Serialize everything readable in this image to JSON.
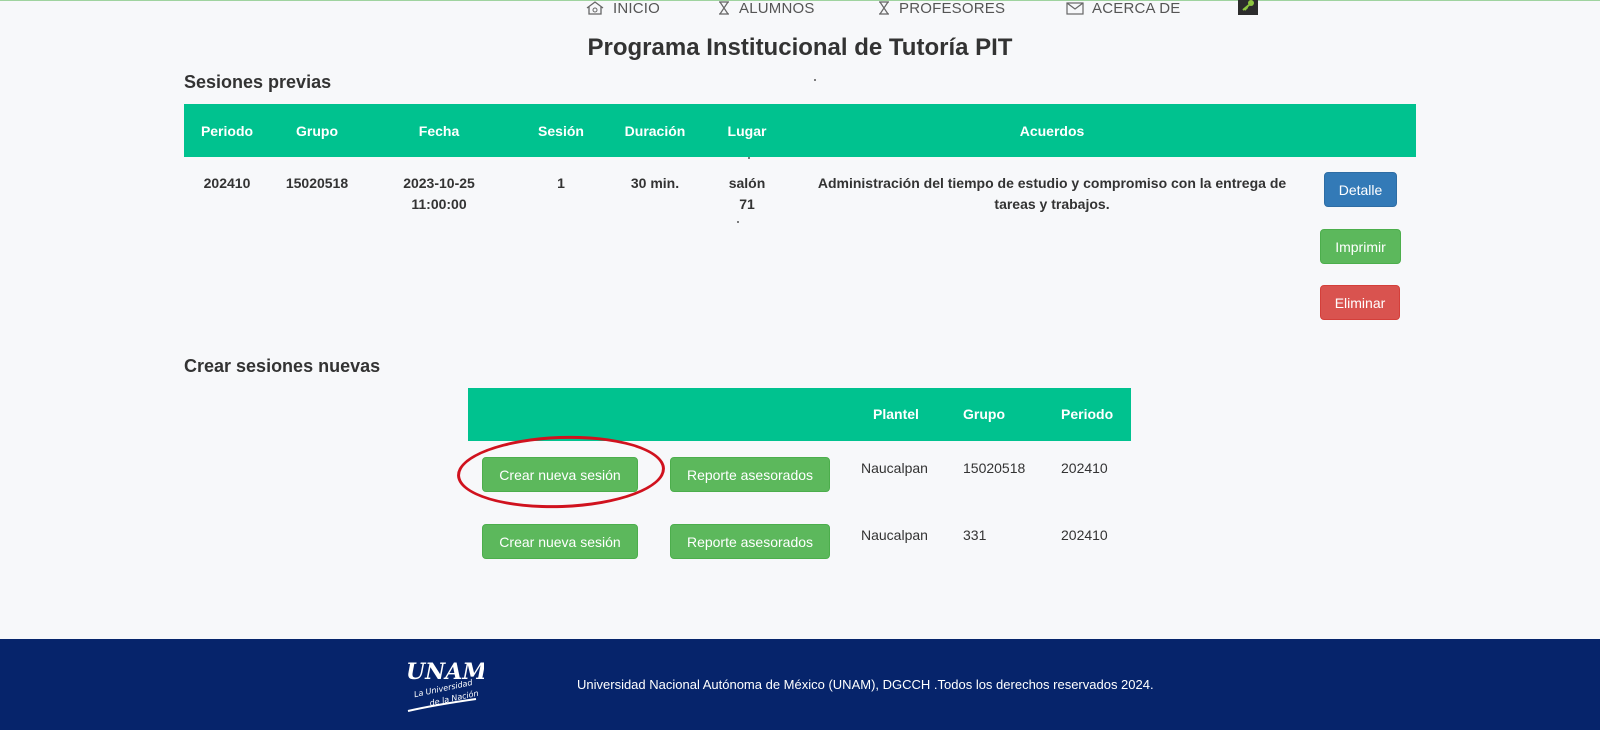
{
  "nav": {
    "items": [
      {
        "label": "INICIO",
        "icon": "home-icon"
      },
      {
        "label": "ALUMNOS",
        "icon": "hourglass-icon"
      },
      {
        "label": "PROFESORES",
        "icon": "hourglass-icon"
      },
      {
        "label": "ACERCA DE",
        "icon": "envelope-icon"
      }
    ],
    "key_icon": "key-icon"
  },
  "page_title": "Programa Institucional de Tutoría PIT",
  "previous_sessions": {
    "title": "Sesiones previas",
    "columns": [
      "Periodo",
      "Grupo",
      "Fecha",
      "Sesión",
      "Duración",
      "Lugar",
      "Acuerdos"
    ],
    "rows": [
      {
        "periodo": "202410",
        "grupo": "15020518",
        "fecha_date": "2023-10-25",
        "fecha_time": "11:00:00",
        "sesion": "1",
        "duracion": "30 min.",
        "lugar_line1": "salón",
        "lugar_line2": "71",
        "acuerdos": "Administración del tiempo de estudio y compromiso con la entrega de tareas y trabajos.",
        "actions": {
          "detail": "Detalle",
          "print": "Imprimir",
          "delete": "Eliminar"
        }
      }
    ]
  },
  "new_sessions": {
    "title": "Crear sesiones nuevas",
    "columns": [
      "Plantel",
      "Grupo",
      "Periodo"
    ],
    "rows": [
      {
        "create_label": "Crear nueva sesión",
        "report_label": "Reporte asesorados",
        "plantel": "Naucalpan",
        "grupo": "15020518",
        "periodo": "202410"
      },
      {
        "create_label": "Crear nueva sesión",
        "report_label": "Reporte asesorados",
        "plantel": "Naucalpan",
        "grupo": "331",
        "periodo": "202410"
      }
    ]
  },
  "footer": {
    "text": "Universidad Nacional Autónoma de México (UNAM), DGCCH .Todos los derechos reservados 2024.",
    "logo": {
      "mark": "UNAM",
      "tagline_1": "La Universidad",
      "tagline_2": "de la Nación"
    }
  },
  "colors": {
    "header_green": "#00c28f",
    "btn_blue": "#337ab7",
    "btn_green": "#5cb85c",
    "btn_red": "#d9534f",
    "footer_blue": "#06246b",
    "annotation_red": "#d0121e"
  }
}
